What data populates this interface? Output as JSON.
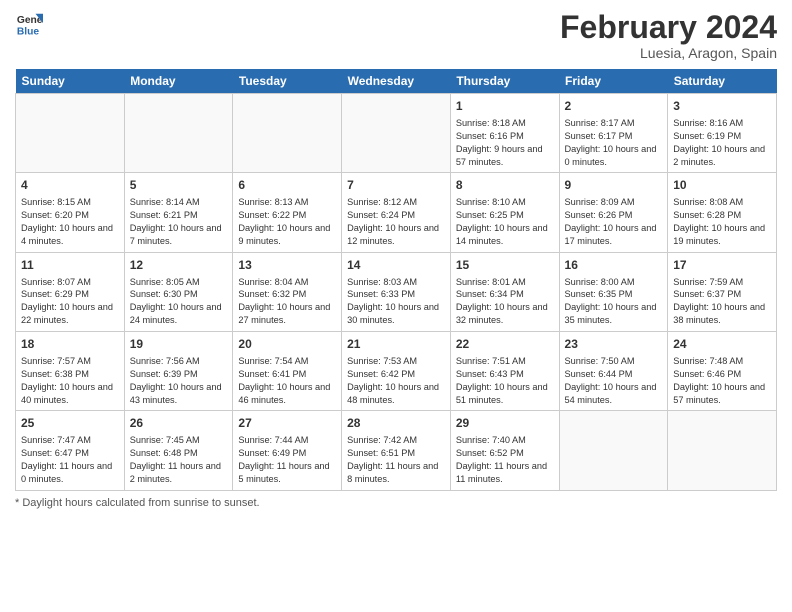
{
  "header": {
    "logo_line1": "General",
    "logo_line2": "Blue",
    "month_title": "February 2024",
    "location": "Luesia, Aragon, Spain"
  },
  "days_of_week": [
    "Sunday",
    "Monday",
    "Tuesday",
    "Wednesday",
    "Thursday",
    "Friday",
    "Saturday"
  ],
  "footer": {
    "note_label": "Daylight hours"
  },
  "weeks": [
    [
      {
        "day": "",
        "info": ""
      },
      {
        "day": "",
        "info": ""
      },
      {
        "day": "",
        "info": ""
      },
      {
        "day": "",
        "info": ""
      },
      {
        "day": "1",
        "info": "Sunrise: 8:18 AM\nSunset: 6:16 PM\nDaylight: 9 hours and 57 minutes."
      },
      {
        "day": "2",
        "info": "Sunrise: 8:17 AM\nSunset: 6:17 PM\nDaylight: 10 hours and 0 minutes."
      },
      {
        "day": "3",
        "info": "Sunrise: 8:16 AM\nSunset: 6:19 PM\nDaylight: 10 hours and 2 minutes."
      }
    ],
    [
      {
        "day": "4",
        "info": "Sunrise: 8:15 AM\nSunset: 6:20 PM\nDaylight: 10 hours and 4 minutes."
      },
      {
        "day": "5",
        "info": "Sunrise: 8:14 AM\nSunset: 6:21 PM\nDaylight: 10 hours and 7 minutes."
      },
      {
        "day": "6",
        "info": "Sunrise: 8:13 AM\nSunset: 6:22 PM\nDaylight: 10 hours and 9 minutes."
      },
      {
        "day": "7",
        "info": "Sunrise: 8:12 AM\nSunset: 6:24 PM\nDaylight: 10 hours and 12 minutes."
      },
      {
        "day": "8",
        "info": "Sunrise: 8:10 AM\nSunset: 6:25 PM\nDaylight: 10 hours and 14 minutes."
      },
      {
        "day": "9",
        "info": "Sunrise: 8:09 AM\nSunset: 6:26 PM\nDaylight: 10 hours and 17 minutes."
      },
      {
        "day": "10",
        "info": "Sunrise: 8:08 AM\nSunset: 6:28 PM\nDaylight: 10 hours and 19 minutes."
      }
    ],
    [
      {
        "day": "11",
        "info": "Sunrise: 8:07 AM\nSunset: 6:29 PM\nDaylight: 10 hours and 22 minutes."
      },
      {
        "day": "12",
        "info": "Sunrise: 8:05 AM\nSunset: 6:30 PM\nDaylight: 10 hours and 24 minutes."
      },
      {
        "day": "13",
        "info": "Sunrise: 8:04 AM\nSunset: 6:32 PM\nDaylight: 10 hours and 27 minutes."
      },
      {
        "day": "14",
        "info": "Sunrise: 8:03 AM\nSunset: 6:33 PM\nDaylight: 10 hours and 30 minutes."
      },
      {
        "day": "15",
        "info": "Sunrise: 8:01 AM\nSunset: 6:34 PM\nDaylight: 10 hours and 32 minutes."
      },
      {
        "day": "16",
        "info": "Sunrise: 8:00 AM\nSunset: 6:35 PM\nDaylight: 10 hours and 35 minutes."
      },
      {
        "day": "17",
        "info": "Sunrise: 7:59 AM\nSunset: 6:37 PM\nDaylight: 10 hours and 38 minutes."
      }
    ],
    [
      {
        "day": "18",
        "info": "Sunrise: 7:57 AM\nSunset: 6:38 PM\nDaylight: 10 hours and 40 minutes."
      },
      {
        "day": "19",
        "info": "Sunrise: 7:56 AM\nSunset: 6:39 PM\nDaylight: 10 hours and 43 minutes."
      },
      {
        "day": "20",
        "info": "Sunrise: 7:54 AM\nSunset: 6:41 PM\nDaylight: 10 hours and 46 minutes."
      },
      {
        "day": "21",
        "info": "Sunrise: 7:53 AM\nSunset: 6:42 PM\nDaylight: 10 hours and 48 minutes."
      },
      {
        "day": "22",
        "info": "Sunrise: 7:51 AM\nSunset: 6:43 PM\nDaylight: 10 hours and 51 minutes."
      },
      {
        "day": "23",
        "info": "Sunrise: 7:50 AM\nSunset: 6:44 PM\nDaylight: 10 hours and 54 minutes."
      },
      {
        "day": "24",
        "info": "Sunrise: 7:48 AM\nSunset: 6:46 PM\nDaylight: 10 hours and 57 minutes."
      }
    ],
    [
      {
        "day": "25",
        "info": "Sunrise: 7:47 AM\nSunset: 6:47 PM\nDaylight: 11 hours and 0 minutes."
      },
      {
        "day": "26",
        "info": "Sunrise: 7:45 AM\nSunset: 6:48 PM\nDaylight: 11 hours and 2 minutes."
      },
      {
        "day": "27",
        "info": "Sunrise: 7:44 AM\nSunset: 6:49 PM\nDaylight: 11 hours and 5 minutes."
      },
      {
        "day": "28",
        "info": "Sunrise: 7:42 AM\nSunset: 6:51 PM\nDaylight: 11 hours and 8 minutes."
      },
      {
        "day": "29",
        "info": "Sunrise: 7:40 AM\nSunset: 6:52 PM\nDaylight: 11 hours and 11 minutes."
      },
      {
        "day": "",
        "info": ""
      },
      {
        "day": "",
        "info": ""
      }
    ]
  ]
}
